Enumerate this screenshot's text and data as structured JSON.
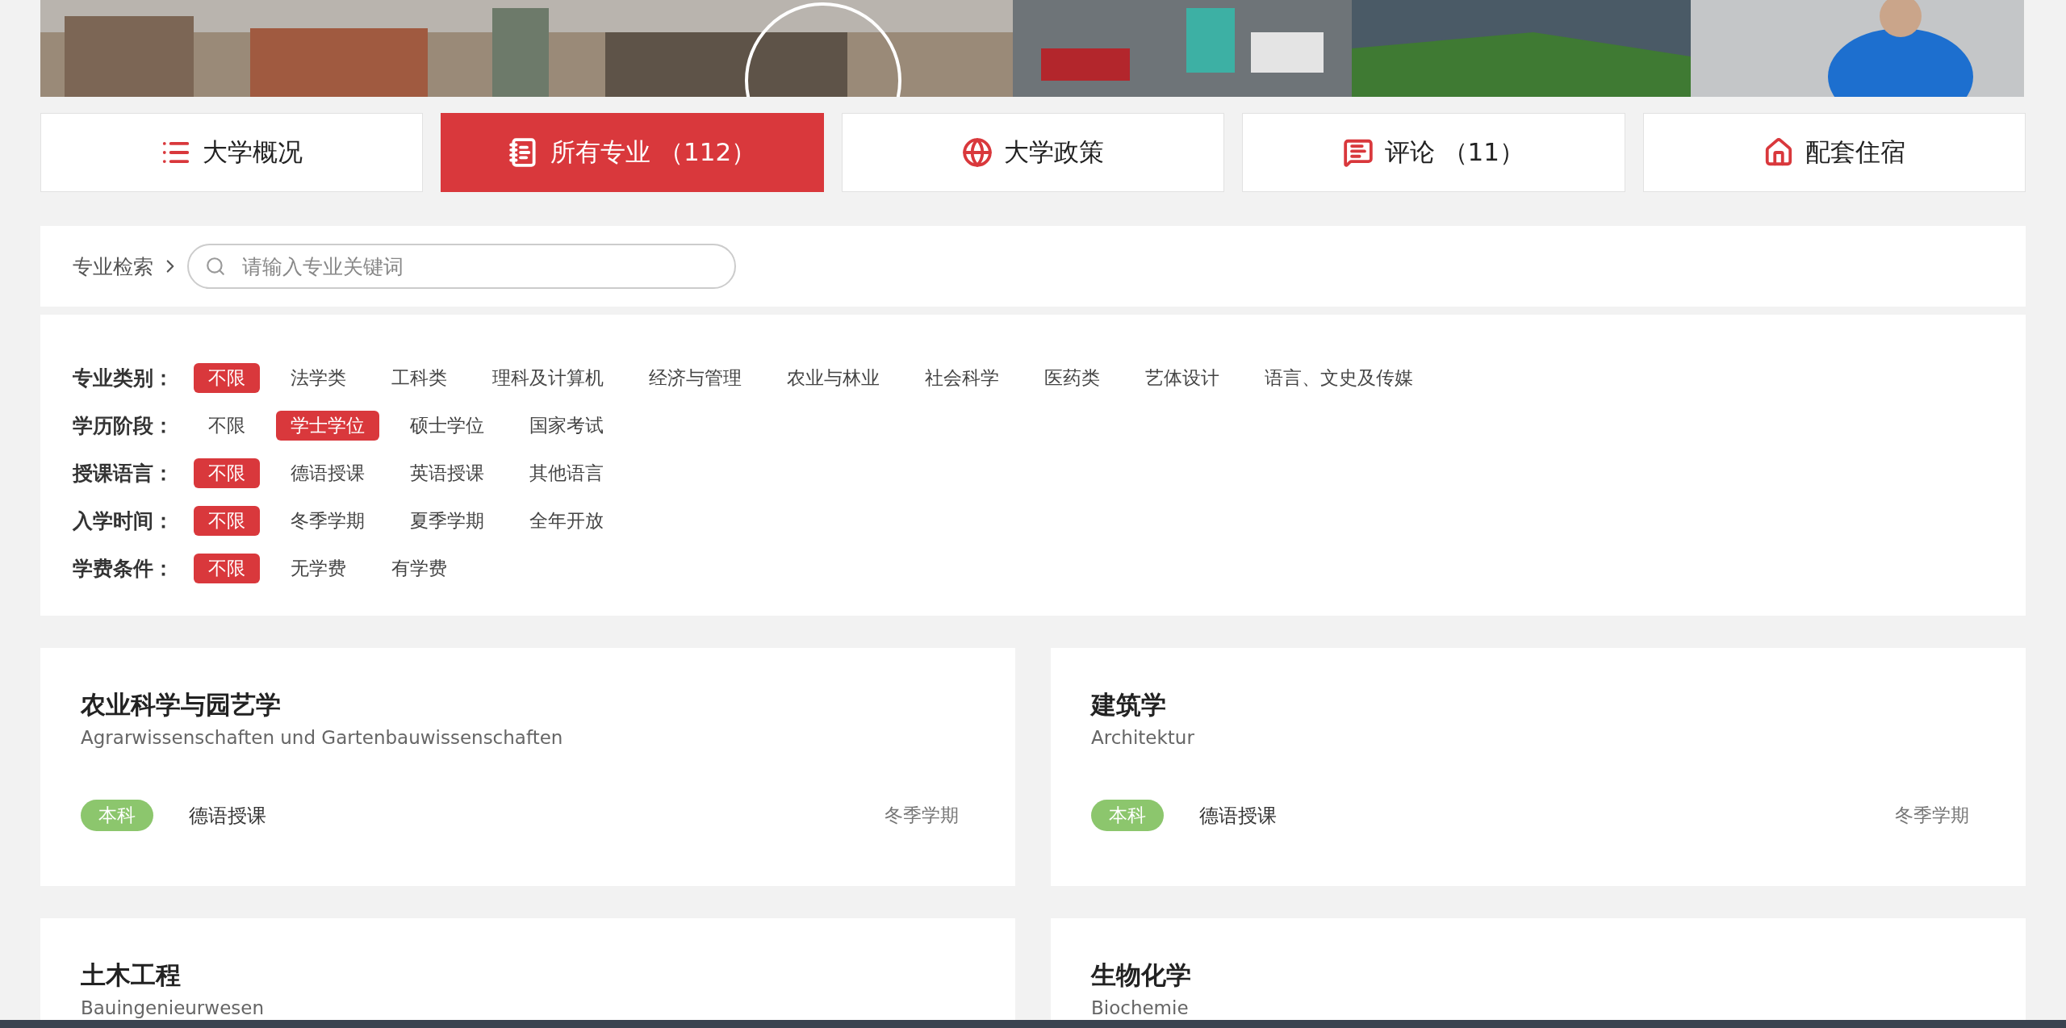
{
  "tabs": [
    {
      "label": "大学概况",
      "selected": false
    },
    {
      "label": "所有专业 （112）",
      "selected": true
    },
    {
      "label": "大学政策",
      "selected": false
    },
    {
      "label": "评论 （11）",
      "selected": false
    },
    {
      "label": "配套住宿",
      "selected": false
    }
  ],
  "search": {
    "label": "专业检索",
    "placeholder": "请输入专业关键词"
  },
  "filters": [
    {
      "label": "专业类别：",
      "options": [
        {
          "label": "不限",
          "selected": true
        },
        {
          "label": "法学类",
          "selected": false
        },
        {
          "label": "工科类",
          "selected": false
        },
        {
          "label": "理科及计算机",
          "selected": false
        },
        {
          "label": "经济与管理",
          "selected": false
        },
        {
          "label": "农业与林业",
          "selected": false
        },
        {
          "label": "社会科学",
          "selected": false
        },
        {
          "label": "医药类",
          "selected": false
        },
        {
          "label": "艺体设计",
          "selected": false
        },
        {
          "label": "语言、文史及传媒",
          "selected": false
        }
      ]
    },
    {
      "label": "学历阶段：",
      "options": [
        {
          "label": "不限",
          "selected": false
        },
        {
          "label": "学士学位",
          "selected": true
        },
        {
          "label": "硕士学位",
          "selected": false
        },
        {
          "label": "国家考试",
          "selected": false
        }
      ]
    },
    {
      "label": "授课语言：",
      "options": [
        {
          "label": "不限",
          "selected": true
        },
        {
          "label": "德语授课",
          "selected": false
        },
        {
          "label": "英语授课",
          "selected": false
        },
        {
          "label": "其他语言",
          "selected": false
        }
      ]
    },
    {
      "label": "入学时间：",
      "options": [
        {
          "label": "不限",
          "selected": true
        },
        {
          "label": "冬季学期",
          "selected": false
        },
        {
          "label": "夏季学期",
          "selected": false
        },
        {
          "label": "全年开放",
          "selected": false
        }
      ]
    },
    {
      "label": "学费条件：",
      "options": [
        {
          "label": "不限",
          "selected": true
        },
        {
          "label": "无学费",
          "selected": false
        },
        {
          "label": "有学费",
          "selected": false
        }
      ]
    }
  ],
  "programs": [
    {
      "title": "农业科学与园艺学",
      "subtitle": "Agrarwissenschaften und Gartenbauwissenschaften",
      "degree": "本科",
      "language": "德语授课",
      "semester": "冬季学期"
    },
    {
      "title": "建筑学",
      "subtitle": "Architektur",
      "degree": "本科",
      "language": "德语授课",
      "semester": "冬季学期"
    },
    {
      "title": "土木工程",
      "subtitle": "Bauingenieurwesen"
    },
    {
      "title": "生物化学",
      "subtitle": "Biochemie"
    }
  ]
}
